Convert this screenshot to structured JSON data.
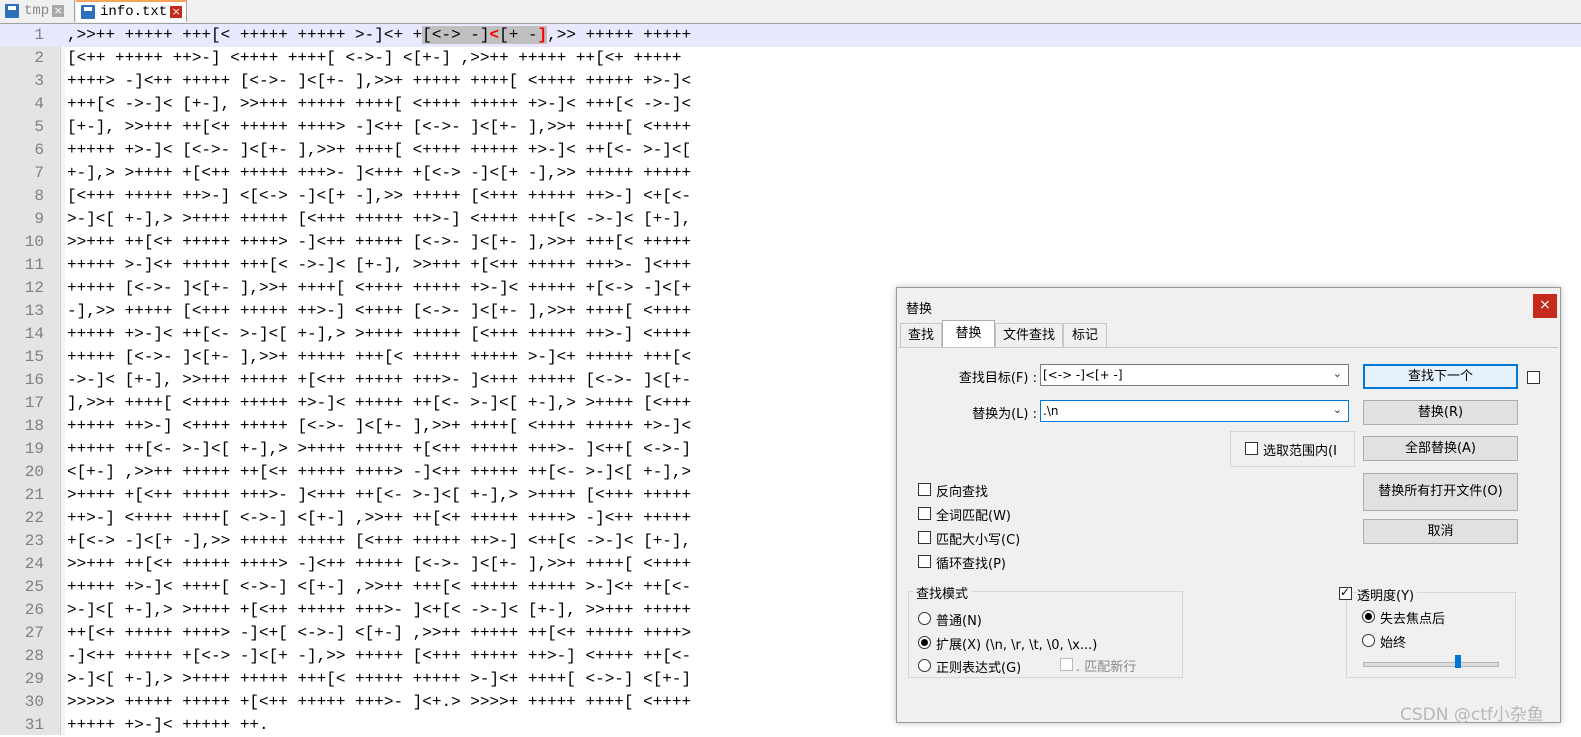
{
  "tabs": [
    {
      "label": "tmp",
      "active": false
    },
    {
      "label": "info.txt",
      "active": true
    }
  ],
  "editor": {
    "current_line": 1,
    "lines": [
      ",>>++ +++++ +++[< +++++ +++++ >-]<+ +",
      "[<++ +++++ ++>-] <++++ ++++[ <->-] <[+-] ,>>++ +++++ ++[<+ +++++",
      "++++> -]<++ +++++ [<->- ]<[+- ],>>+ +++++ ++++[ <++++ +++++ +>-]<",
      "+++[< ->-]< [+-], >>+++ +++++ ++++[ <++++ +++++ +>-]< +++[< ->-]<",
      "[+-], >>+++ ++[<+ +++++ ++++> -]<++ [<->- ]<[+- ],>>+ ++++[ <++++",
      "+++++ +>-]< [<->- ]<[+- ],>>+ ++++[ <++++ +++++ +>-]< ++[<- >-]<[",
      "+-],> >++++ +[<++ +++++ +++>- ]<+++ +[<-> -]<[+ -],>> +++++ +++++",
      "[<+++ +++++ ++>-] <[<-> -]<[+ -],>> +++++ [<+++ +++++ ++>-] <+[<-",
      ">-]<[ +-],> >++++ +++++ [<+++ +++++ ++>-] <++++ +++[< ->-]< [+-],",
      ">>+++ ++[<+ +++++ ++++> -]<++ +++++ [<->- ]<[+- ],>>+ +++[< +++++",
      "+++++ >-]<+ +++++ +++[< ->-]< [+-], >>+++ +[<++ +++++ +++>- ]<+++",
      "+++++ [<->- ]<[+- ],>>+ ++++[ <++++ +++++ +>-]< +++++ +[<-> -]<[+",
      "-],>> +++++ [<+++ +++++ ++>-] <++++ [<->- ]<[+- ],>>+ ++++[ <++++",
      "+++++ +>-]< ++[<- >-]<[ +-],> >++++ +++++ [<+++ +++++ ++>-] <++++",
      "+++++ [<->- ]<[+- ],>>+ +++++ +++[< +++++ +++++ >-]<+ +++++ +++[<",
      "->-]< [+-], >>+++ +++++ +[<++ +++++ +++>- ]<+++ +++++ [<->- ]<[+-",
      "],>>+ ++++[ <++++ +++++ +>-]< +++++ ++[<- >-]<[ +-],> >++++ [<+++",
      "+++++ ++>-] <++++ +++++ [<->- ]<[+- ],>>+ ++++[ <++++ +++++ +>-]<",
      "+++++ ++[<- >-]<[ +-],> >++++ +++++ +[<++ +++++ +++>- ]<++[ <->-]",
      "<[+-] ,>>++ +++++ ++[<+ +++++ ++++> -]<++ +++++ ++[<- >-]<[ +-],>",
      ">++++ +[<++ +++++ +++>- ]<+++ ++[<- >-]<[ +-],> >++++ [<+++ +++++",
      "++>-] <++++ ++++[ <->-] <[+-] ,>>++ ++[<+ +++++ ++++> -]<++ +++++",
      "+[<-> -]<[+ -],>> +++++ +++++ [<+++ +++++ ++>-] <++[< ->-]< [+-],",
      ">>+++ ++[<+ +++++ ++++> -]<++ +++++ [<->- ]<[+- ],>>+ ++++[ <++++",
      "+++++ +>-]< ++++[ <->-] <[+-] ,>>++ +++[< +++++ +++++ >-]<+ ++[<-",
      ">-]<[ +-],> >++++ +[<++ +++++ +++>- ]<+[< ->-]< [+-], >>+++ +++++",
      "++[<+ +++++ ++++> -]<+[ <->-] <[+-] ,>>++ +++++ ++[<+ +++++ ++++>",
      "-]<++ +++++ +[<-> -]<[+ -],>> +++++ [<+++ +++++ ++>-] <++++ ++[<-",
      ">-]<[ +-],> >++++ +++++ +++[< +++++ +++++ >-]<+ ++++[ <->-] <[+-]",
      ">>>>> +++++ +++++ +[<++ +++++ +++>- ]<+.> >>>>+ +++++ ++++[ <++++",
      "+++++ +>-]< +++++ ++."
    ],
    "line1_selection": "[<-> -]<[+ -]",
    "line1_tail": ",>> +++++ +++++"
  },
  "dialog": {
    "title": "替换",
    "close_label": "×",
    "tabs": [
      "查找",
      "替换",
      "文件查找",
      "标记"
    ],
    "active_tab": "替换",
    "find_label": "查找目标(F) :",
    "find_value": "[<-> -]<[+ -]",
    "replace_label": "替换为(L) :",
    "replace_value": ".\\n",
    "buttons": {
      "find_next": "查找下一个",
      "replace": "替换(R)",
      "replace_all": "全部替换(A)",
      "replace_all_open": "替换所有打开文件(O)",
      "cancel": "取消"
    },
    "in_selection": "选取范围内(I",
    "options": {
      "backward": "反向查找",
      "whole_word": "全词匹配(W)",
      "match_case": "匹配大小写(C)",
      "wrap": "循环查找(P)"
    },
    "search_mode": {
      "title": "查找模式",
      "normal": "普通(N)",
      "extended": "扩展(X) (\\n, \\r, \\t, \\0, \\x...)",
      "regex": "正则表达式(G)",
      "dot_newline": ". 匹配新行",
      "selected": "extended"
    },
    "transparency": {
      "title": "透明度(Y)",
      "checked": true,
      "on_lose_focus": "失去焦点后",
      "always": "始终",
      "selected": "on_lose_focus",
      "level": 0.72
    }
  },
  "watermark": "CSDN @ctf小杂鱼",
  "colors": {
    "current_line": "#e8e8ff",
    "selection": "#c0c0c0",
    "accent": "#0078d7",
    "close": "#c42b1c"
  },
  "icons": [
    "save-icon",
    "close-icon",
    "chevron-down-icon"
  ]
}
